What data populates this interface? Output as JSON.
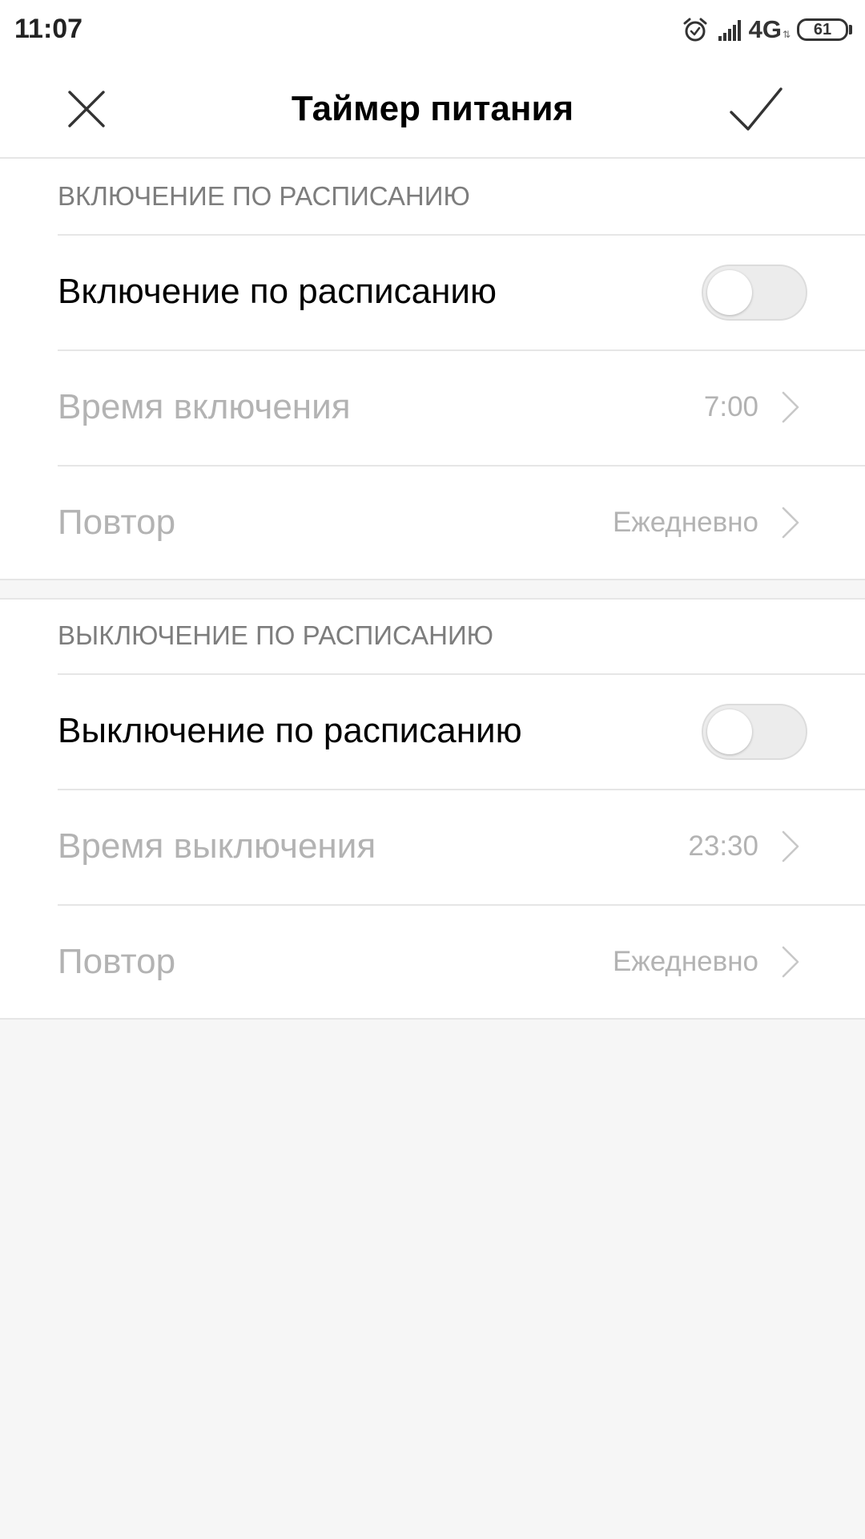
{
  "status_bar": {
    "time": "11:07",
    "network": "4G",
    "network_arrows": "⇅",
    "battery_level": "61",
    "icons": [
      "alarm-icon",
      "signal-icon",
      "battery-icon"
    ]
  },
  "app_bar": {
    "title": "Таймер питания",
    "close_icon": "close-icon",
    "confirm_icon": "check-icon"
  },
  "schedule_on": {
    "header": "ВКЛЮЧЕНИЕ ПО РАСПИСАНИЮ",
    "toggle_label": "Включение по расписанию",
    "toggle_on": false,
    "time_label": "Время включения",
    "time_value": "7:00",
    "repeat_label": "Повтор",
    "repeat_value": "Ежедневно"
  },
  "schedule_off": {
    "header": "ВЫКЛЮЧЕНИЕ ПО РАСПИСАНИЮ",
    "toggle_label": "Выключение по расписанию",
    "toggle_on": false,
    "time_label": "Время выключения",
    "time_value": "23:30",
    "repeat_label": "Повтор",
    "repeat_value": "Ежедневно"
  },
  "colors": {
    "page_background": "#f6f6f6",
    "card_background": "#ffffff",
    "divider": "#e6e6e6",
    "disabled_text": "#b3b3b3",
    "section_header_text": "#7d7d7d",
    "toggle_track": "#ececec"
  }
}
